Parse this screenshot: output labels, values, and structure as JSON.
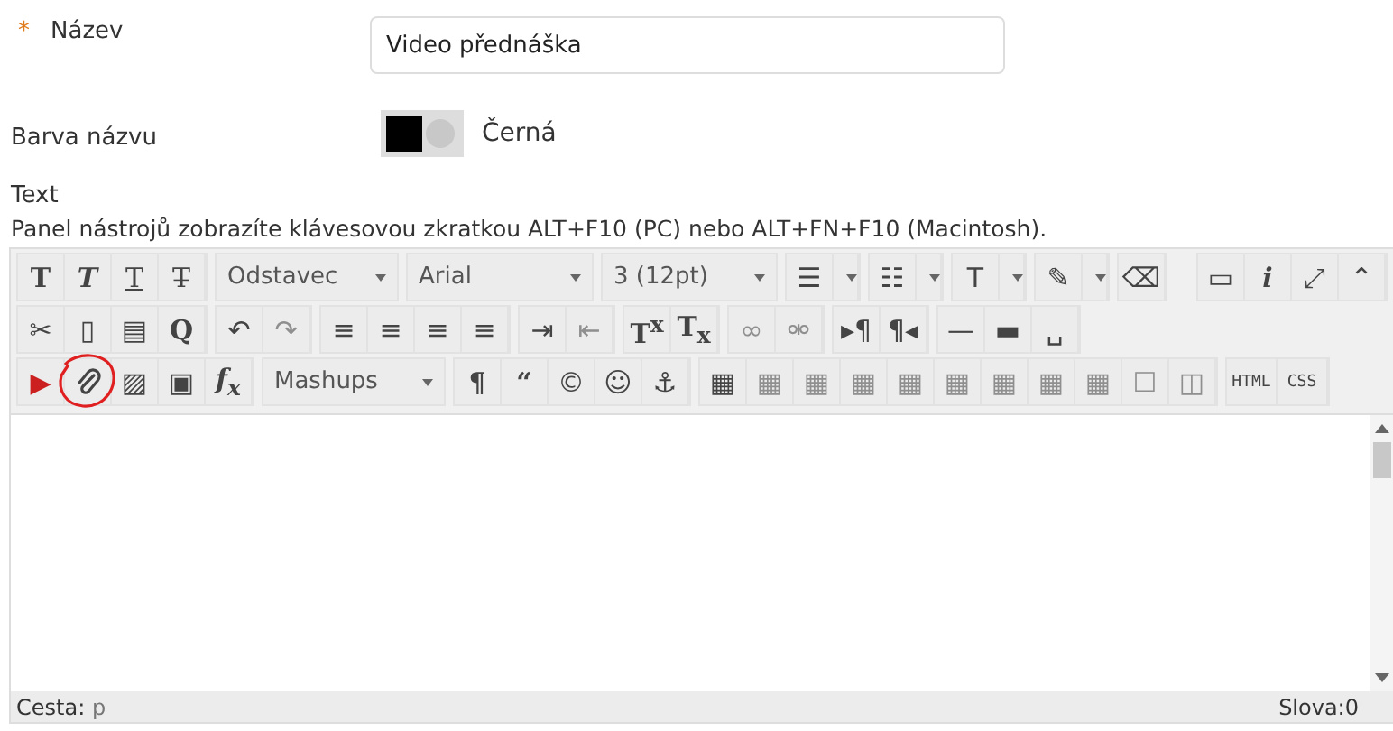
{
  "form": {
    "name_field": {
      "label": "Název",
      "required_marker": "*",
      "value": "Video přednáška"
    },
    "color_field": {
      "label": "Barva názvu",
      "value": "Černá",
      "color": "#000000"
    },
    "text_label": "Text",
    "hint": "Panel nástrojů zobrazíte klávesovou zkratkou ALT+F10 (PC) nebo ALT+FN+F10 (Macintosh)."
  },
  "toolbar": {
    "lines": [
      {
        "groups": [
          {
            "items": [
              {
                "kind": "bold",
                "glyph": "T",
                "disabled": false
              },
              {
                "kind": "italic",
                "glyph": "T",
                "disabled": false
              },
              {
                "kind": "underline",
                "glyph": "T",
                "disabled": false
              },
              {
                "kind": "strike",
                "glyph": "T̶",
                "disabled": false
              }
            ]
          },
          {
            "items": [
              {
                "kind": "select",
                "value": "Odstavec"
              }
            ]
          },
          {
            "items": [
              {
                "kind": "select",
                "value": "Arial"
              }
            ]
          },
          {
            "items": [
              {
                "kind": "select",
                "value": "3 (12pt)"
              }
            ]
          },
          {
            "items": [
              {
                "kind": "split",
                "glyph": "☰",
                "disabled": false
              }
            ]
          },
          {
            "items": [
              {
                "kind": "split",
                "glyph": "☷",
                "disabled": false
              }
            ]
          },
          {
            "items": [
              {
                "kind": "split",
                "glyph": "T",
                "disabled": false
              }
            ]
          },
          {
            "items": [
              {
                "kind": "split",
                "glyph": "✎",
                "disabled": false
              }
            ]
          },
          {
            "items": [
              {
                "kind": "glyph",
                "glyph": "⌫",
                "disabled": false
              }
            ]
          }
        ],
        "end_groups": [
          {
            "items": [
              {
                "kind": "glyph",
                "glyph": "▭",
                "disabled": false
              },
              {
                "kind": "italic",
                "glyph": "i",
                "disabled": false
              },
              {
                "kind": "glyph",
                "glyph": "⤢",
                "disabled": false
              },
              {
                "kind": "glyph",
                "glyph": "⌃",
                "disabled": false
              }
            ]
          }
        ]
      },
      {
        "groups": [
          {
            "items": [
              {
                "kind": "glyph",
                "glyph": "✂",
                "disabled": false
              },
              {
                "kind": "glyph",
                "glyph": "▯",
                "disabled": false
              },
              {
                "kind": "glyph",
                "glyph": "▤",
                "disabled": false
              },
              {
                "kind": "bold",
                "glyph": "Q",
                "disabled": false
              }
            ]
          },
          {
            "items": [
              {
                "kind": "glyph",
                "glyph": "↶",
                "disabled": false
              },
              {
                "kind": "glyph",
                "glyph": "↷",
                "disabled": true
              }
            ]
          },
          {
            "items": [
              {
                "kind": "glyph",
                "glyph": "≡",
                "disabled": false
              },
              {
                "kind": "glyph",
                "glyph": "≡",
                "disabled": false
              },
              {
                "kind": "glyph",
                "glyph": "≡",
                "disabled": false
              },
              {
                "kind": "glyph",
                "glyph": "≡",
                "disabled": false
              }
            ]
          },
          {
            "items": [
              {
                "kind": "glyph",
                "glyph": "⇥",
                "disabled": false
              },
              {
                "kind": "glyph",
                "glyph": "⇤",
                "disabled": true
              }
            ]
          },
          {
            "items": [
              {
                "kind": "bold",
                "glyph": "T$^{x}$",
                "disabled": false
              },
              {
                "kind": "bold",
                "glyph": "T$_{x}$",
                "disabled": false
              }
            ]
          },
          {
            "items": [
              {
                "kind": "glyph",
                "glyph": "∞",
                "disabled": true
              },
              {
                "kind": "glyph",
                "glyph": "⚮",
                "disabled": true
              }
            ]
          },
          {
            "items": [
              {
                "kind": "glyph",
                "glyph": "▸¶",
                "disabled": false
              },
              {
                "kind": "glyph",
                "glyph": "¶◂",
                "disabled": false
              }
            ]
          },
          {
            "items": [
              {
                "kind": "glyph",
                "glyph": "—",
                "disabled": false
              },
              {
                "kind": "glyph",
                "glyph": "▬",
                "disabled": false
              },
              {
                "kind": "glyph",
                "glyph": "␣",
                "disabled": false
              }
            ]
          }
        ]
      },
      {
        "groups": [
          {
            "items": [
              {
                "kind": "glyph",
                "glyph": "▶",
                "color": "#cc1f1f",
                "disabled": false
              },
              {
                "kind": "attach",
                "circled": true,
                "disabled": false
              },
              {
                "kind": "glyph",
                "glyph": "▨",
                "disabled": false
              },
              {
                "kind": "glyph",
                "glyph": "▣",
                "disabled": false
              },
              {
                "kind": "serif",
                "glyph": "f$_{x}$",
                "disabled": false
              }
            ]
          },
          {
            "items": [
              {
                "kind": "select",
                "value": "Mashups"
              }
            ]
          },
          {
            "items": [
              {
                "kind": "bold",
                "glyph": "¶",
                "disabled": false
              },
              {
                "kind": "bold",
                "glyph": "“",
                "disabled": false
              },
              {
                "kind": "glyph",
                "glyph": "©",
                "disabled": false
              },
              {
                "kind": "glyph",
                "glyph": "☺",
                "disabled": false
              },
              {
                "kind": "glyph",
                "glyph": "⚓",
                "disabled": false
              }
            ]
          },
          {
            "items": [
              {
                "kind": "glyph",
                "glyph": "▦",
                "disabled": false
              },
              {
                "kind": "glyph",
                "glyph": "▦",
                "disabled": true
              },
              {
                "kind": "glyph",
                "glyph": "▦",
                "disabled": true
              },
              {
                "kind": "glyph",
                "glyph": "▦",
                "disabled": true
              },
              {
                "kind": "glyph",
                "glyph": "▦",
                "disabled": true
              },
              {
                "kind": "glyph",
                "glyph": "▦",
                "disabled": true
              },
              {
                "kind": "glyph",
                "glyph": "▦",
                "disabled": true
              },
              {
                "kind": "glyph",
                "glyph": "▦",
                "disabled": true
              },
              {
                "kind": "glyph",
                "glyph": "▦",
                "disabled": true
              },
              {
                "kind": "glyph",
                "glyph": "☐",
                "disabled": true
              },
              {
                "kind": "glyph",
                "glyph": "◫",
                "disabled": true
              }
            ]
          },
          {
            "items": [
              {
                "kind": "mono",
                "glyph": "HTML",
                "disabled": false
              },
              {
                "kind": "mono",
                "glyph": "CSS",
                "disabled": false
              }
            ]
          }
        ]
      }
    ]
  },
  "status_bar": {
    "path_label": "Cesta:",
    "path": "p",
    "word_count": "Slova:0"
  }
}
